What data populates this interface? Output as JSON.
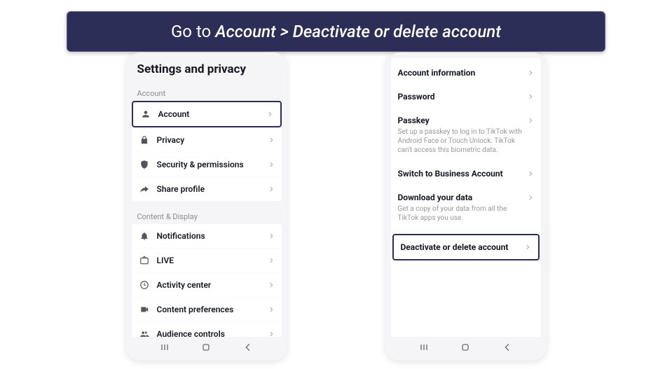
{
  "instruction": {
    "prefix": "Go to ",
    "path": "Account > Deactivate or delete account"
  },
  "left": {
    "title": "Settings and privacy",
    "section_account": "Account",
    "section_content": "Content & Display",
    "items_account": [
      {
        "label": "Account"
      },
      {
        "label": "Privacy"
      },
      {
        "label": "Security & permissions"
      },
      {
        "label": "Share profile"
      }
    ],
    "items_content": [
      {
        "label": "Notifications"
      },
      {
        "label": "LIVE"
      },
      {
        "label": "Activity center"
      },
      {
        "label": "Content preferences"
      },
      {
        "label": "Audience controls"
      }
    ]
  },
  "right": {
    "rows": [
      {
        "label": "Account information",
        "desc": ""
      },
      {
        "label": "Password",
        "desc": ""
      },
      {
        "label": "Passkey",
        "desc": "Set up a passkey to log in to TikTok with Android Face or Touch Unlock. TikTok can't access this biometric data."
      },
      {
        "label": "Switch to Business Account",
        "desc": ""
      },
      {
        "label": "Download your data",
        "desc": "Get a copy of your data from all the TikTok apps you use."
      },
      {
        "label": "Deactivate or delete account",
        "desc": ""
      }
    ]
  }
}
